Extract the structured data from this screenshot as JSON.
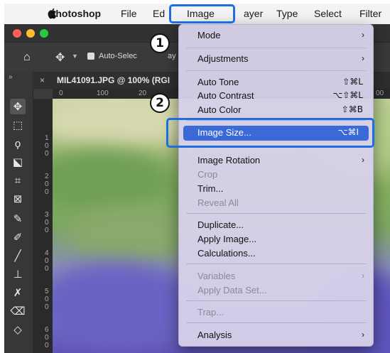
{
  "menubar": {
    "app": "Photoshop",
    "items": [
      "File",
      "Ed",
      "Image",
      "ayer",
      "Type",
      "Select",
      "Filter"
    ]
  },
  "options_bar": {
    "auto_select_label": "Auto-Selec",
    "auto_select_suffix": "ay"
  },
  "document_tab": {
    "title": "MIL41091.JPG @ 100% (RGI"
  },
  "ruler_top": {
    "marks": [
      "0",
      "100",
      "20",
      "00"
    ]
  },
  "ruler_left": {
    "marks": [
      "1\n0\n0",
      "2\n0\n0",
      "3\n0\n0",
      "4\n0\n0",
      "5\n0\n0",
      "6\n0\n0"
    ]
  },
  "image_menu": {
    "items": [
      {
        "label": "Mode",
        "shortcut": "",
        "submenu": true,
        "disabled": false
      },
      {
        "label": "Adjustments",
        "shortcut": "",
        "submenu": true,
        "disabled": false
      },
      {
        "label": "Auto Tone",
        "shortcut": "⇧⌘L",
        "submenu": false,
        "disabled": false
      },
      {
        "label": "Auto Contrast",
        "shortcut": "⌥⇧⌘L",
        "submenu": false,
        "disabled": false
      },
      {
        "label": "Auto Color",
        "shortcut": "⇧⌘B",
        "submenu": false,
        "disabled": false
      },
      {
        "label": "Image Size...",
        "shortcut": "⌥⌘I",
        "submenu": false,
        "disabled": false,
        "highlighted": true
      },
      {
        "label": "Image Rotation",
        "shortcut": "",
        "submenu": true,
        "disabled": false
      },
      {
        "label": "Crop",
        "shortcut": "",
        "submenu": false,
        "disabled": true
      },
      {
        "label": "Trim...",
        "shortcut": "",
        "submenu": false,
        "disabled": false
      },
      {
        "label": "Reveal All",
        "shortcut": "",
        "submenu": false,
        "disabled": true
      },
      {
        "label": "Duplicate...",
        "shortcut": "",
        "submenu": false,
        "disabled": false
      },
      {
        "label": "Apply Image...",
        "shortcut": "",
        "submenu": false,
        "disabled": false
      },
      {
        "label": "Calculations...",
        "shortcut": "",
        "submenu": false,
        "disabled": false
      },
      {
        "label": "Variables",
        "shortcut": "",
        "submenu": true,
        "disabled": true
      },
      {
        "label": "Apply Data Set...",
        "shortcut": "",
        "submenu": false,
        "disabled": true
      },
      {
        "label": "Trap...",
        "shortcut": "",
        "submenu": false,
        "disabled": true
      },
      {
        "label": "Analysis",
        "shortcut": "",
        "submenu": true,
        "disabled": false
      }
    ]
  },
  "annotations": {
    "step1": "1",
    "step2": "2"
  },
  "colors": {
    "highlight": "#3b6ad8",
    "callout_outline": "#1f6ee0",
    "menu_bg": "#d6d0e9"
  }
}
